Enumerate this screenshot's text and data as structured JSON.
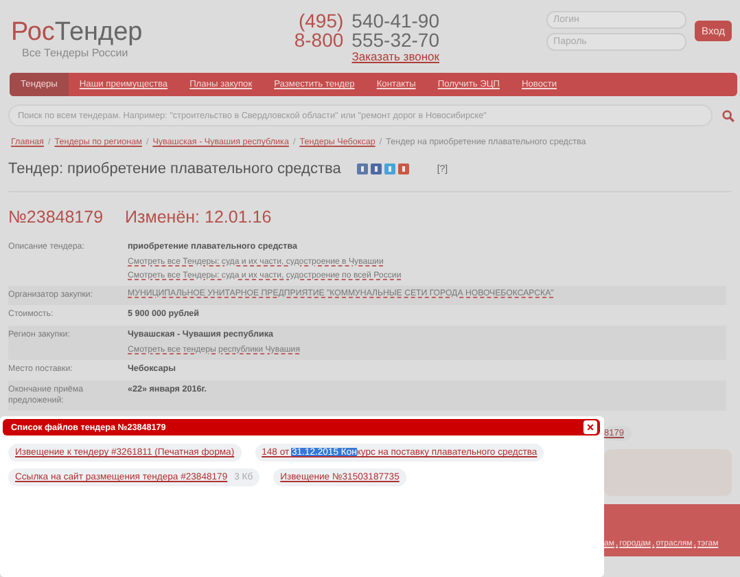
{
  "header": {
    "logo": {
      "first": "Рос",
      "second": "Тендер",
      "tagline": "Все Тендеры России"
    },
    "phones": [
      {
        "code": "(495)",
        "number": "540-41-90"
      },
      {
        "code": "8-800",
        "number": "555-32-70"
      }
    ],
    "callback_link": "Заказать звонок",
    "login": {
      "login_placeholder": "Логин",
      "password_placeholder": "Пароль",
      "button": "Вход"
    }
  },
  "nav": [
    {
      "label": "Тендеры",
      "selected": true
    },
    {
      "label": "Наши преимущества",
      "selected": false
    },
    {
      "label": "Планы закупок",
      "selected": false
    },
    {
      "label": "Разместить тендер",
      "selected": false
    },
    {
      "label": "Контакты",
      "selected": false
    },
    {
      "label": "Получить ЭЦП",
      "selected": false
    },
    {
      "label": "Новости",
      "selected": false
    }
  ],
  "search": {
    "placeholder": "Поиск по всем тендерам. Например: \"строительство в Свердловской области\" или \"ремонт дорог в Новосибирске\""
  },
  "breadcrumb_separator": "/",
  "breadcrumbs": [
    {
      "label": "Главная",
      "kind": "link"
    },
    {
      "label": "Тендеры по регионам",
      "kind": "link"
    },
    {
      "label": "Чувашская - Чувашия республика",
      "kind": "link"
    },
    {
      "label": "Тендеры Чебоксар",
      "kind": "link"
    },
    {
      "label": "Тендер на приобретение плавательного средства",
      "kind": "current"
    }
  ],
  "title": "Тендер: приобретение плавательного средства",
  "help": "[?]",
  "tender_number": "№23848179",
  "changed": "Изменён: 12.01.16",
  "details": [
    {
      "label": "Описание тендера:",
      "values": [
        {
          "text": "приобретение плавательного средства",
          "kind": "bold"
        },
        {
          "text": "Смотреть все Тендеры: суда и их части, судостроение в Чувашии",
          "kind": "link"
        },
        {
          "text": "Смотреть все Тендеры: суда и их части, судостроение по всей России",
          "kind": "link"
        }
      ]
    },
    {
      "label": "Организатор закупки:",
      "values": [
        {
          "text": "МУНИЦИПАЛЬНОЕ УНИТАРНОЕ ПРЕДПРИЯТИЕ \"КОММУНАЛЬНЫЕ СЕТИ ГОРОДА НОВОЧЕБОКСАРСКА\"",
          "kind": "link"
        }
      ]
    },
    {
      "label": "Стоимость:",
      "values": [
        {
          "text": "5 900 000 рублей",
          "kind": "bold"
        }
      ]
    },
    {
      "label": "Регион закупки:",
      "values": [
        {
          "text": "Чувашская - Чувашия республика",
          "kind": "bold"
        },
        {
          "text": "Смотреть все тендеры республики Чувашия",
          "kind": "link"
        }
      ]
    },
    {
      "label": "Место поставки:",
      "values": [
        {
          "text": "Чебоксары",
          "kind": "bold"
        }
      ]
    },
    {
      "label": "Окончание приёма предложений:",
      "values": [
        {
          "text": "«22» января 2016г.",
          "kind": "bold"
        }
      ]
    }
  ],
  "background": {
    "file_link": "8179",
    "link_separator": ",",
    "bottom_links": [
      "ам",
      "городам",
      "отраслям",
      "тэгам"
    ]
  },
  "popup": {
    "title": "Список файлов тендера №23848179",
    "close": "×",
    "files": [
      {
        "text": "Извещение к тендеру #3261811 (Печатная форма)"
      },
      {
        "text": "148 от ",
        "selected_text": "31.12.2015 Кон",
        "text_after": "курс на поставку плавательного средства"
      },
      {
        "text": "Ссылка на сайт размещения тендера #23848179",
        "size": "3 Кб"
      },
      {
        "text": "Извещение №31503187735"
      }
    ]
  }
}
